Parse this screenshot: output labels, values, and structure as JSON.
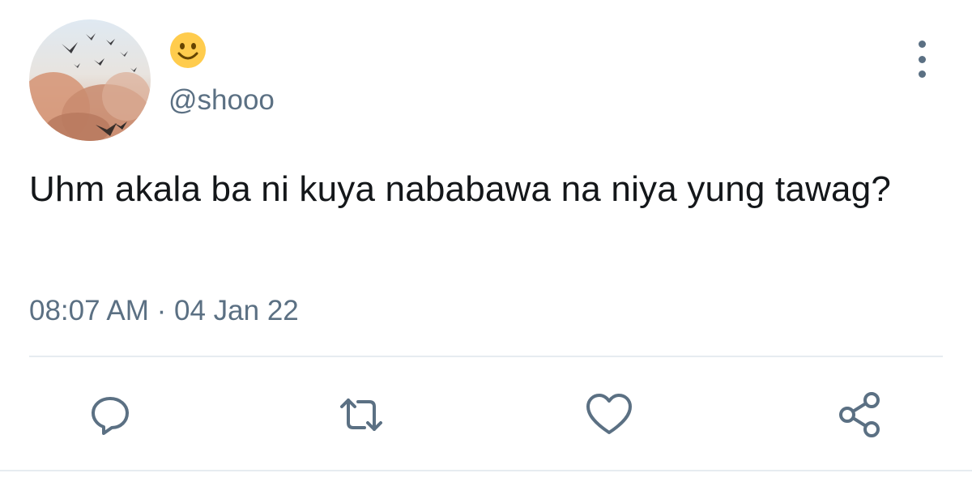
{
  "tweet": {
    "display_name_emoji": "smiling-face-emoji",
    "handle": "@shooo",
    "text": "Uhm akala ba ni kuya nababawa na niya yung tawag?",
    "time": "08:07 AM",
    "separator": "·",
    "date": "04 Jan 22"
  },
  "actions": [
    "reply",
    "retweet",
    "like",
    "share"
  ],
  "colors": {
    "text": "#14171a",
    "secondary": "#5b7083",
    "divider": "#e6ecf0",
    "emoji": "#ffcc4d"
  }
}
